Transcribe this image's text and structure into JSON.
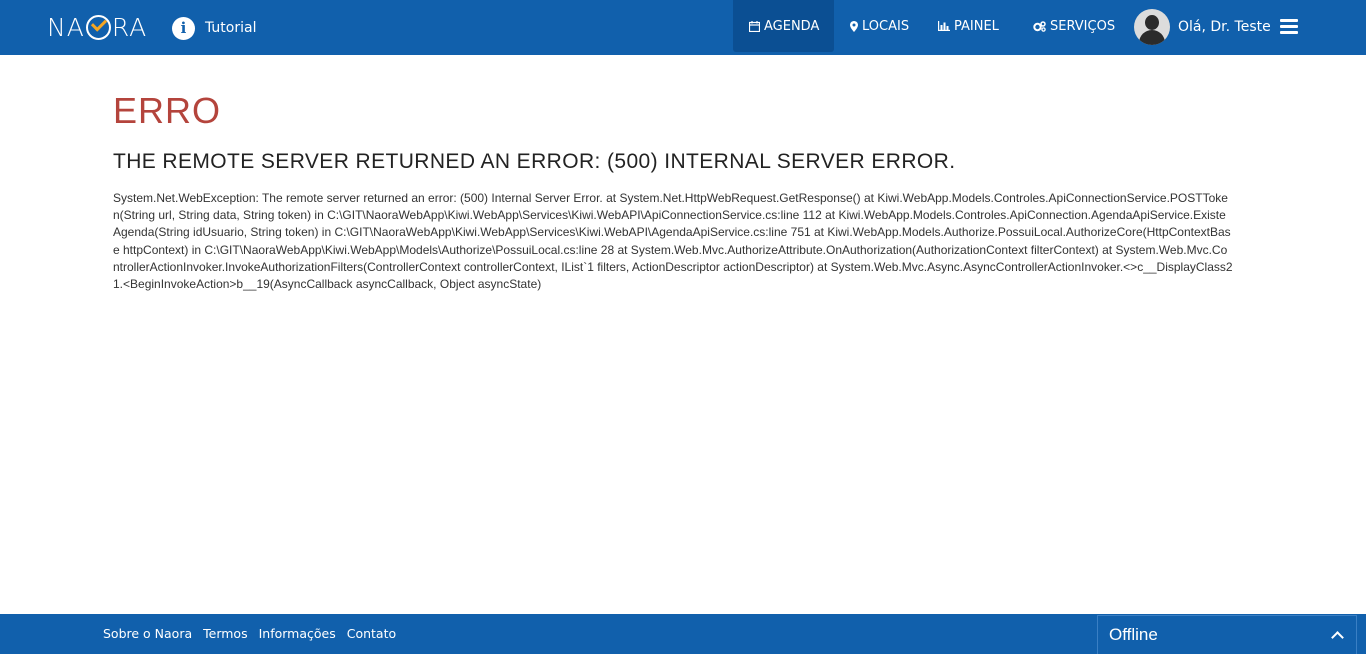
{
  "header": {
    "logo_text_left": "NA",
    "logo_text_right": "RA",
    "tutorial_label": "Tutorial",
    "nav": [
      {
        "label": "AGENDA",
        "icon": "calendar-icon",
        "active": true
      },
      {
        "label": "LOCAIS",
        "icon": "map-marker-icon",
        "active": false
      },
      {
        "label": "PAINEL",
        "icon": "bar-chart-icon",
        "active": false
      },
      {
        "label": "SERVIÇOS",
        "icon": "cogs-icon",
        "active": false
      }
    ],
    "user_greeting": "Olá, Dr. Teste"
  },
  "error": {
    "title": "ERRO",
    "message": "THE REMOTE SERVER RETURNED AN ERROR: (500) INTERNAL SERVER ERROR.",
    "trace": "System.Net.WebException: The remote server returned an error: (500) Internal Server Error. at System.Net.HttpWebRequest.GetResponse() at Kiwi.WebApp.Models.Controles.ApiConnectionService.POSTToken(String url, String data, String token) in C:\\GIT\\NaoraWebApp\\Kiwi.WebApp\\Services\\Kiwi.WebAPI\\ApiConnectionService.cs:line 112 at Kiwi.WebApp.Models.Controles.ApiConnection.AgendaApiService.ExisteAgenda(String idUsuario, String token) in C:\\GIT\\NaoraWebApp\\Kiwi.WebApp\\Services\\Kiwi.WebAPI\\AgendaApiService.cs:line 751 at Kiwi.WebApp.Models.Authorize.PossuiLocal.AuthorizeCore(HttpContextBase httpContext) in C:\\GIT\\NaoraWebApp\\Kiwi.WebApp\\Models\\Authorize\\PossuiLocal.cs:line 28 at System.Web.Mvc.AuthorizeAttribute.OnAuthorization(AuthorizationContext filterContext) at System.Web.Mvc.ControllerActionInvoker.InvokeAuthorizationFilters(ControllerContext controllerContext, IList`1 filters, ActionDescriptor actionDescriptor) at System.Web.Mvc.Async.AsyncControllerActionInvoker.<>c__DisplayClass21.<BeginInvokeAction>b__19(AsyncCallback asyncCallback, Object asyncState)"
  },
  "footer": {
    "links": [
      "Sobre o Naora",
      "Termos",
      "Informações",
      "Contato"
    ],
    "chat_status": "Offline"
  },
  "colors": {
    "brand_blue": "#1160ac",
    "active_nav": "#0b4f93",
    "error_red": "#b4443c",
    "logo_accent": "#f5a623"
  }
}
